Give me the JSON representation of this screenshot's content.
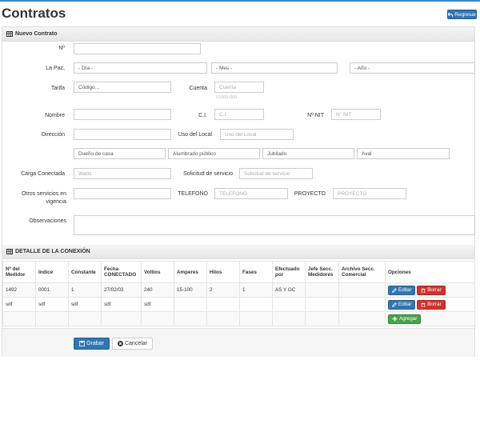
{
  "page": {
    "title": "Contratos",
    "back_label": "Regresar"
  },
  "form": {
    "header": "Nuevo Contrato",
    "numero": {
      "label": "Nº",
      "value": ""
    },
    "fecha": {
      "label": "La Paz,",
      "dia": "- Día -",
      "mes": "- Mes -",
      "anio": "- Año -"
    },
    "tarifa": {
      "label": "Tarifa",
      "value": "Código..."
    },
    "cuenta": {
      "label": "Cuenta",
      "placeholder": "Cuenta",
      "hint": "01000-000"
    },
    "nombre": {
      "label": "Nombre",
      "value": ""
    },
    "ci": {
      "label": "C.I.",
      "placeholder": "C.I."
    },
    "nit": {
      "label": "Nº NIT",
      "placeholder": "N° NIT"
    },
    "direccion": {
      "label": "Dirección",
      "value": ""
    },
    "uso_local": {
      "label": "Uso del Local",
      "placeholder": "Uso del Local"
    },
    "tipos": [
      "Dueño de casa",
      "Alumbrado público",
      "Jubilado",
      "Aval"
    ],
    "carga": {
      "label": "Carga Conectada",
      "placeholder": "Watts"
    },
    "solicitud": {
      "label": "Solicitud de servicio",
      "placeholder": "Solicitud de servicio"
    },
    "otros": {
      "label_line1": "Otros servicios en",
      "label_line2": "vigencia",
      "value": ""
    },
    "telefono": {
      "label": "TELEFONO",
      "placeholder": "TELEFONO"
    },
    "proyecto": {
      "label": "PROYECTO",
      "placeholder": "PROYECTO"
    },
    "observaciones": {
      "label": "Observaciones",
      "value": ""
    }
  },
  "detalle": {
    "header": "DETALLE DE LA CONEXIÓN",
    "columns": [
      [
        "Nº del",
        "Medidor"
      ],
      [
        "Indice",
        ""
      ],
      [
        "Constante",
        ""
      ],
      [
        "Fecha",
        "CONECTADO"
      ],
      [
        "Voltios",
        ""
      ],
      [
        "Amperes",
        ""
      ],
      [
        "Hilos",
        ""
      ],
      [
        "Fases",
        ""
      ],
      [
        "Efectuado",
        "por"
      ],
      [
        "Jefe Secc.",
        "Medidores"
      ],
      [
        "Archivo Secc.",
        "Comercial"
      ],
      [
        "Opciones",
        ""
      ]
    ],
    "rows": [
      [
        "1492",
        "0001",
        "1",
        "27/02/03",
        "240",
        "15-100",
        "2",
        "1",
        "AS Y GC",
        "",
        ""
      ],
      [
        "sdf",
        "sdf",
        "sdf",
        "sdf",
        "sdf",
        "",
        "",
        "",
        "",
        "",
        ""
      ]
    ],
    "edit_label": "Editar",
    "delete_label": "Borrar",
    "add_label": "Agregar"
  },
  "actions": {
    "save_label": "Grabar",
    "cancel_label": "Cancelar"
  },
  "colors": {
    "primary": "#3276b1",
    "danger": "#d2322d",
    "success": "#47a447",
    "accent_line": "#3a87c9"
  }
}
